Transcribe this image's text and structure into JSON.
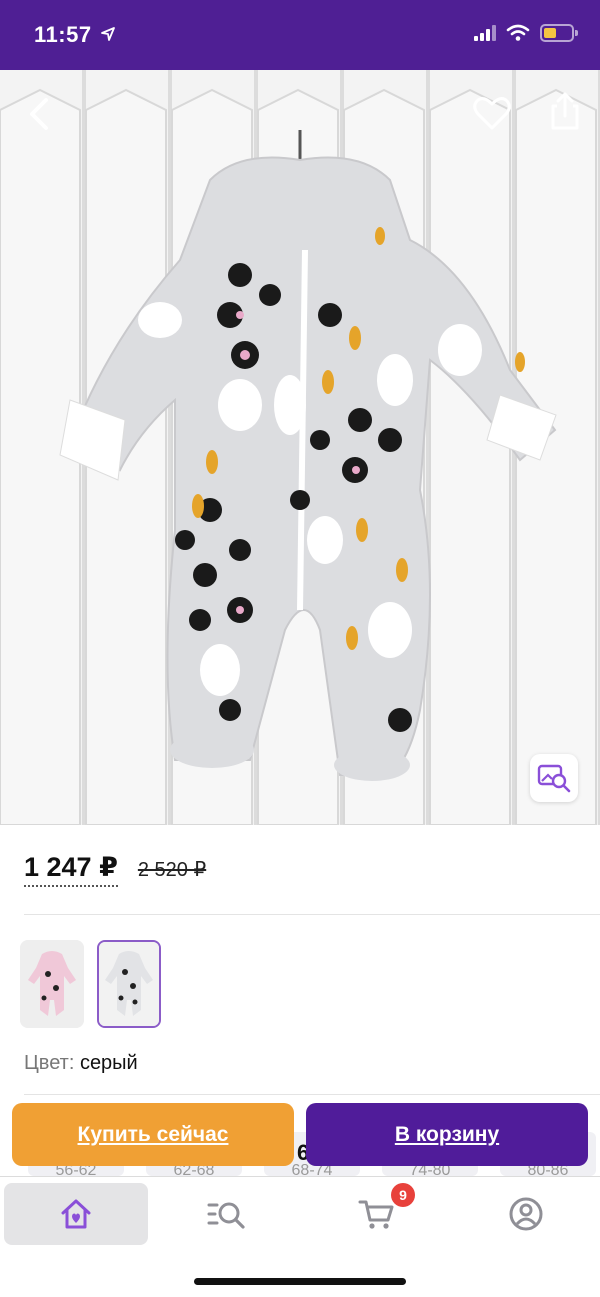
{
  "status_bar": {
    "time": "11:57",
    "battery_color": "#f4c542",
    "background": "#4f1f94"
  },
  "product": {
    "image_description_icons": [
      "back-arrow",
      "heart",
      "share",
      "visual-search"
    ],
    "price_current": "1 247 ₽",
    "price_old": "2 520 ₽",
    "color_label": "Цвет:",
    "color_value": "серый"
  },
  "sizes": [
    "56-62",
    "62-68",
    "68-74",
    "74-80",
    "80-86"
  ],
  "actions": {
    "buy_now": "Купить сейчас",
    "add_to_cart": "В корзину",
    "partial_text": "6"
  },
  "tab_bar": {
    "tabs": [
      "home",
      "catalog-search",
      "cart",
      "profile"
    ],
    "cart_badge": "9",
    "accent": "#8a4fd8"
  }
}
